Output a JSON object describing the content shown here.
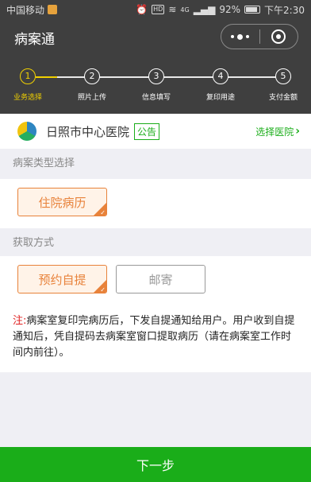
{
  "status_bar": {
    "carrier": "中国移动",
    "network": "4G",
    "battery": "92%",
    "time": "下午2:30",
    "hd": "HD"
  },
  "nav": {
    "title": "病案通",
    "more_icon": "more-dots-icon",
    "close_icon": "target-circle-icon"
  },
  "steps": [
    {
      "num": "1",
      "label": "业务选择",
      "active": true
    },
    {
      "num": "2",
      "label": "照片上传",
      "active": false
    },
    {
      "num": "3",
      "label": "信息填写",
      "active": false
    },
    {
      "num": "4",
      "label": "复印用途",
      "active": false
    },
    {
      "num": "5",
      "label": "支付金额",
      "active": false
    }
  ],
  "hospital": {
    "name": "日照市中心医院",
    "notice": "公告",
    "choose": "选择医院",
    "chevron": "›"
  },
  "record_type": {
    "title": "病案类型选择",
    "options": [
      "住院病历"
    ],
    "selected": "住院病历"
  },
  "pickup": {
    "title": "获取方式",
    "options": [
      "预约自提",
      "邮寄"
    ],
    "selected": "预约自提"
  },
  "note": {
    "prefix": "注:",
    "text": "病案室复印完病历后，下发自提通知给用户。用户收到自提通知后，凭自提码去病案室窗口提取病历（请在病案室工作时间内前往）。"
  },
  "next_button": "下一步",
  "colors": {
    "accent": "#1aad19",
    "orange": "#e8823a",
    "step_active": "#f0d000",
    "header": "#3f3f3f"
  }
}
